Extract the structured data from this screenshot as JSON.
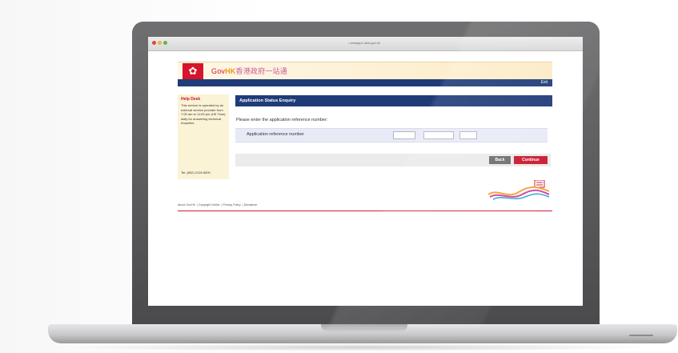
{
  "browser": {
    "url": "• webapp1.hkid.gov.hk"
  },
  "header": {
    "logo_gov": "Gov",
    "logo_hk": "HK",
    "logo_cn": "香港政府一站通",
    "exit_label": "Exit"
  },
  "help": {
    "title": "Help Desk",
    "body": "This service is operated by an external service provider from 7:00 am to 11:00 pm (HK Time) daily for answering technical enquiries.",
    "tel": "Tel: (852) 2126 8000"
  },
  "main": {
    "section_title": "Application Status Enquiry",
    "instruction": "Please enter the application reference number:",
    "ref_label": "Application reference number",
    "ref_values": [
      "",
      "",
      ""
    ],
    "back_label": "Back",
    "continue_label": "Continue"
  },
  "footer": {
    "links": [
      "About GovHK",
      "Copyright Notice",
      "Privacy Policy",
      "Disclaimer"
    ]
  },
  "colors": {
    "nav": "#1f3b78",
    "accent_red": "#c9172c",
    "help_bg": "#fbf3d6"
  }
}
